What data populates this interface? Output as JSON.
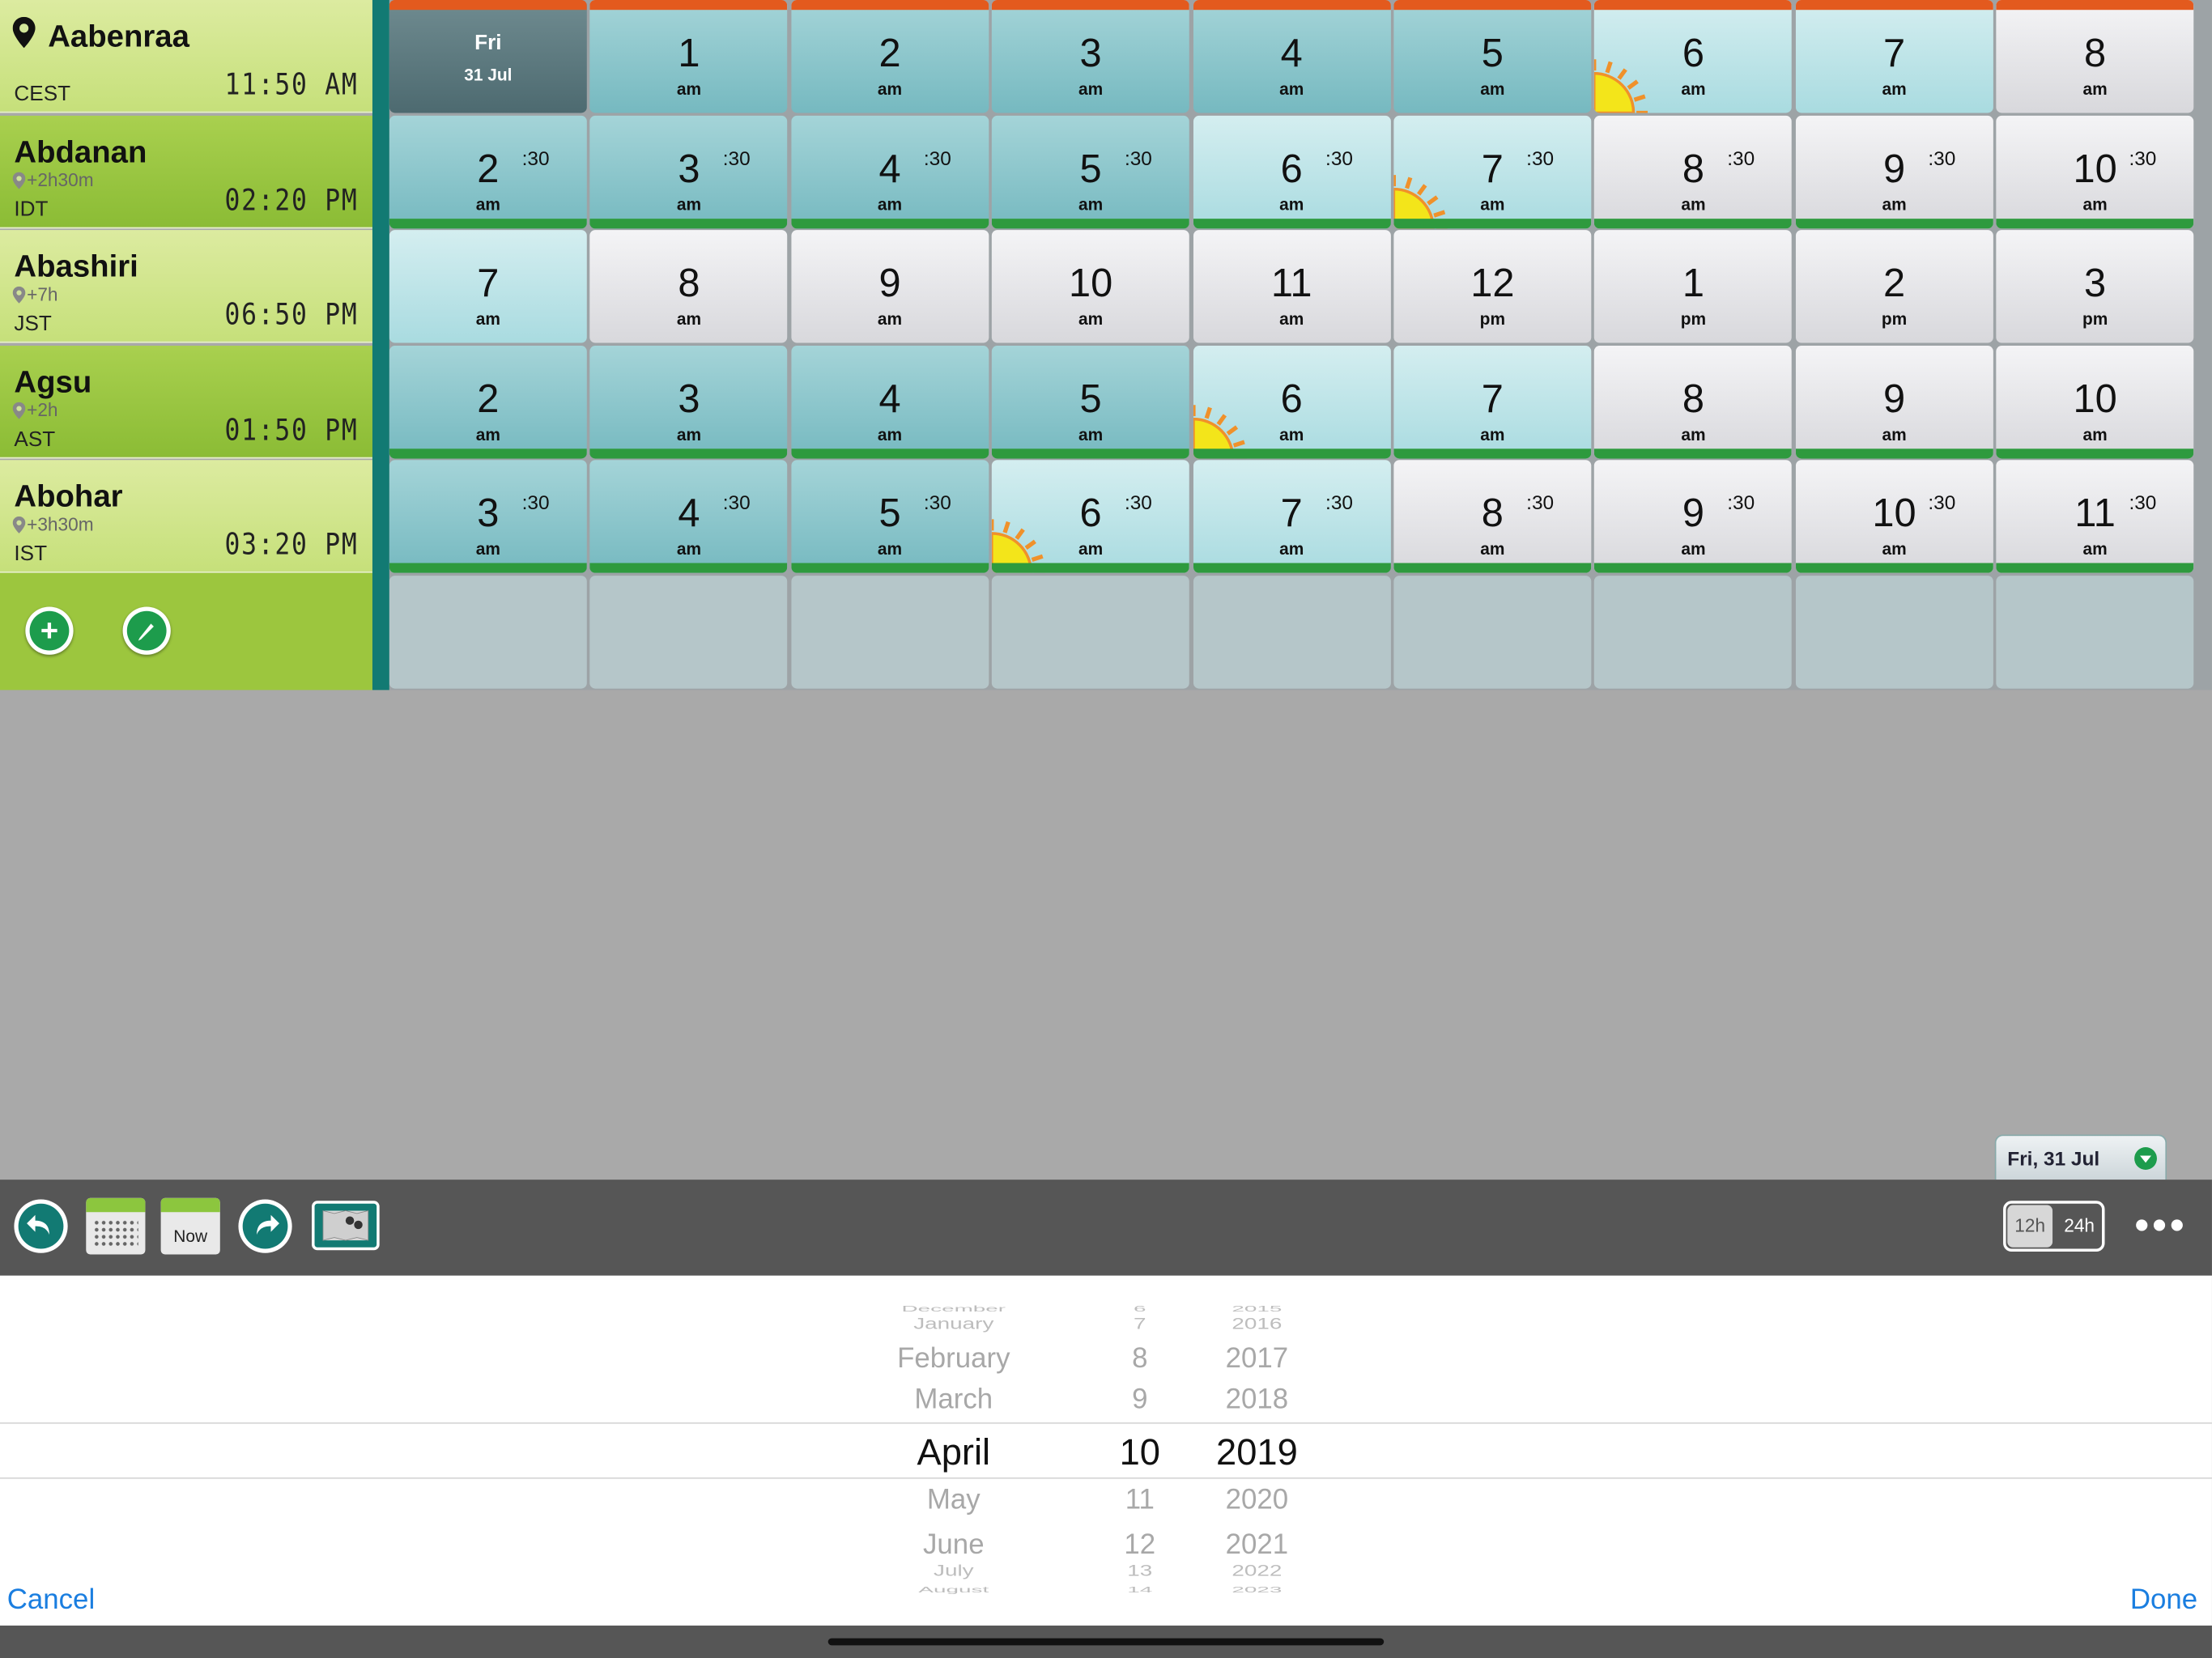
{
  "cities": [
    {
      "name": "Aabenraa",
      "offset": "",
      "abbr": "CEST",
      "time": "11:50 AM",
      "home": true
    },
    {
      "name": "Abdanan",
      "offset": "+2h30m",
      "abbr": "IDT",
      "time": "02:20 PM"
    },
    {
      "name": "Abashiri",
      "offset": "+7h",
      "abbr": "JST",
      "time": "06:50 PM"
    },
    {
      "name": "Agsu",
      "offset": "+2h",
      "abbr": "AST",
      "time": "01:50 PM"
    },
    {
      "name": "Abohar",
      "offset": "+3h30m",
      "abbr": "IST",
      "time": "03:20 PM"
    }
  ],
  "grid": {
    "today": {
      "day": "Fri",
      "date": "31 Jul"
    },
    "rows": [
      [
        {
          "today": true
        },
        {
          "h": "1",
          "ap": "am",
          "t": "night"
        },
        {
          "h": "2",
          "ap": "am",
          "t": "night"
        },
        {
          "h": "3",
          "ap": "am",
          "t": "night"
        },
        {
          "h": "4",
          "ap": "am",
          "t": "night"
        },
        {
          "h": "5",
          "ap": "am",
          "t": "night"
        },
        {
          "h": "6",
          "ap": "am",
          "t": "dawn",
          "sun": true
        },
        {
          "h": "7",
          "ap": "am",
          "t": "dawn"
        },
        {
          "h": "8",
          "ap": "am",
          "t": "day"
        }
      ],
      [
        {
          "h": "2",
          "ap": "am",
          "t": "night",
          "half": ":30"
        },
        {
          "h": "3",
          "ap": "am",
          "t": "night",
          "half": ":30"
        },
        {
          "h": "4",
          "ap": "am",
          "t": "night",
          "half": ":30"
        },
        {
          "h": "5",
          "ap": "am",
          "t": "night",
          "half": ":30"
        },
        {
          "h": "6",
          "ap": "am",
          "t": "dawn",
          "half": ":30"
        },
        {
          "h": "7",
          "ap": "am",
          "t": "dawn",
          "half": ":30",
          "sun": true
        },
        {
          "h": "8",
          "ap": "am",
          "t": "day",
          "half": ":30"
        },
        {
          "h": "9",
          "ap": "am",
          "t": "day",
          "half": ":30"
        },
        {
          "h": "10",
          "ap": "am",
          "t": "day",
          "half": ":30"
        }
      ],
      [
        {
          "h": "7",
          "ap": "am",
          "t": "dawn"
        },
        {
          "h": "8",
          "ap": "am",
          "t": "day"
        },
        {
          "h": "9",
          "ap": "am",
          "t": "day"
        },
        {
          "h": "10",
          "ap": "am",
          "t": "day"
        },
        {
          "h": "11",
          "ap": "am",
          "t": "day"
        },
        {
          "h": "12",
          "ap": "pm",
          "t": "day"
        },
        {
          "h": "1",
          "ap": "pm",
          "t": "day"
        },
        {
          "h": "2",
          "ap": "pm",
          "t": "day"
        },
        {
          "h": "3",
          "ap": "pm",
          "t": "day"
        }
      ],
      [
        {
          "h": "2",
          "ap": "am",
          "t": "night"
        },
        {
          "h": "3",
          "ap": "am",
          "t": "night"
        },
        {
          "h": "4",
          "ap": "am",
          "t": "night"
        },
        {
          "h": "5",
          "ap": "am",
          "t": "night"
        },
        {
          "h": "6",
          "ap": "am",
          "t": "dawn",
          "sun": true
        },
        {
          "h": "7",
          "ap": "am",
          "t": "dawn"
        },
        {
          "h": "8",
          "ap": "am",
          "t": "day"
        },
        {
          "h": "9",
          "ap": "am",
          "t": "day"
        },
        {
          "h": "10",
          "ap": "am",
          "t": "day"
        }
      ],
      [
        {
          "h": "3",
          "ap": "am",
          "t": "night",
          "half": ":30"
        },
        {
          "h": "4",
          "ap": "am",
          "t": "night",
          "half": ":30"
        },
        {
          "h": "5",
          "ap": "am",
          "t": "night",
          "half": ":30"
        },
        {
          "h": "6",
          "ap": "am",
          "t": "dawn",
          "half": ":30",
          "sun": true
        },
        {
          "h": "7",
          "ap": "am",
          "t": "dawn",
          "half": ":30"
        },
        {
          "h": "8",
          "ap": "am",
          "t": "day",
          "half": ":30"
        },
        {
          "h": "9",
          "ap": "am",
          "t": "day",
          "half": ":30"
        },
        {
          "h": "10",
          "ap": "am",
          "t": "day",
          "half": ":30"
        },
        {
          "h": "11",
          "ap": "am",
          "t": "day",
          "half": ":30"
        }
      ]
    ]
  },
  "date_tab": {
    "label": "Fri, 31 Jul"
  },
  "toolbar": {
    "now_label": "Now",
    "fmt_12": "12h",
    "fmt_24": "24h",
    "more": "•••"
  },
  "picker": {
    "months": [
      "December",
      "January",
      "February",
      "March",
      "April",
      "May",
      "June",
      "July",
      "August"
    ],
    "days": [
      "6",
      "7",
      "8",
      "9",
      "10",
      "11",
      "12",
      "13",
      "14"
    ],
    "years": [
      "2015",
      "2016",
      "2017",
      "2018",
      "2019",
      "2020",
      "2021",
      "2022",
      "2023"
    ],
    "selected": {
      "month": "April",
      "day": "10",
      "year": "2019"
    },
    "cancel": "Cancel",
    "done": "Done"
  },
  "colors": {
    "teal": "#127a73",
    "green": "#2e9a3e",
    "orange": "#e35a1e",
    "link": "#1a7ee0"
  }
}
